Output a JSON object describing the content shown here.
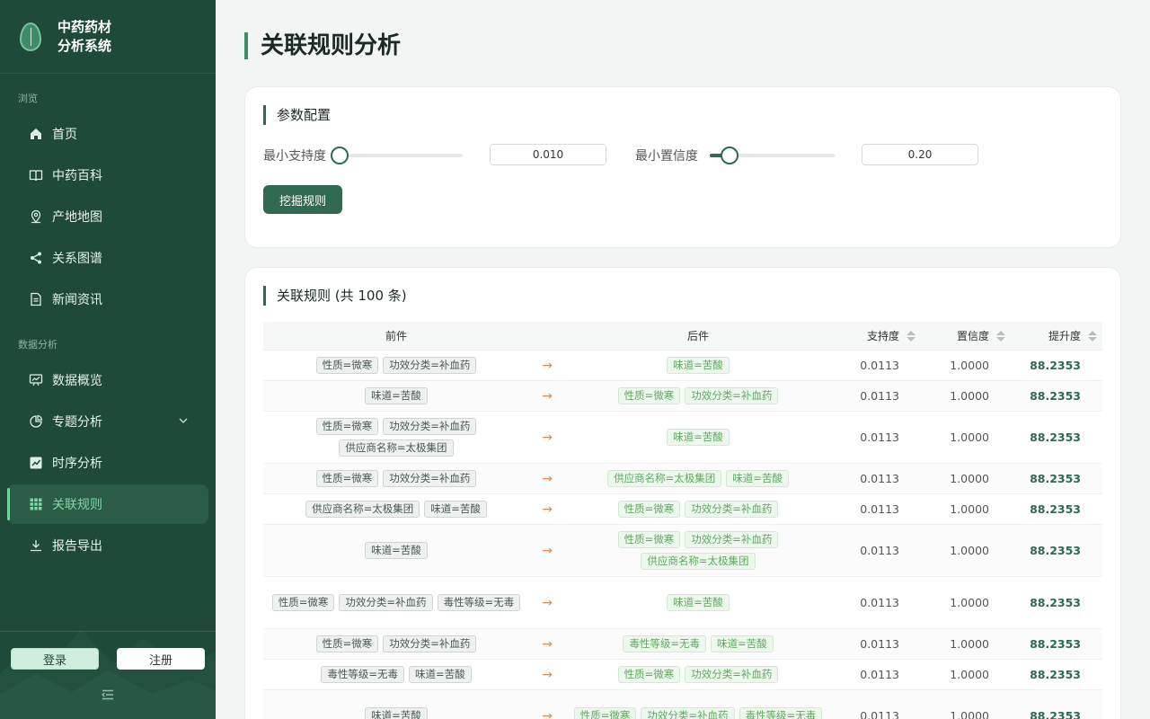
{
  "brand": {
    "title_line1": "中药药材",
    "title_line2": "分析系统"
  },
  "sidebar": {
    "section_browse": "浏览",
    "section_analysis": "数据分析",
    "items": [
      {
        "label": "首页",
        "icon": "home-icon"
      },
      {
        "label": "中药百科",
        "icon": "book-icon"
      },
      {
        "label": "产地地图",
        "icon": "map-pin-icon"
      },
      {
        "label": "关系图谱",
        "icon": "share-icon"
      },
      {
        "label": "新闻资讯",
        "icon": "document-icon"
      },
      {
        "label": "数据概览",
        "icon": "dashboard-icon"
      },
      {
        "label": "专题分析",
        "icon": "pie-chart-icon"
      },
      {
        "label": "时序分析",
        "icon": "line-chart-icon"
      },
      {
        "label": "关联规则",
        "icon": "grid-icon",
        "active": true
      },
      {
        "label": "报告导出",
        "icon": "download-icon"
      }
    ],
    "login_label": "登录",
    "register_label": "注册"
  },
  "page": {
    "title": "关联规则分析"
  },
  "params": {
    "title": "参数配置",
    "min_support_label": "最小支持度",
    "min_support_value": "0.010",
    "min_support_fraction": 0.0,
    "min_confidence_label": "最小置信度",
    "min_confidence_value": "0.20",
    "min_confidence_fraction": 0.16,
    "mine_button": "挖掘规则"
  },
  "rules": {
    "title": "关联规则 (共 100 条)",
    "columns": {
      "antecedent": "前件",
      "consequent": "后件",
      "support": "支持度",
      "confidence": "置信度",
      "lift": "提升度"
    },
    "arrow": "→",
    "rows": [
      {
        "a": [
          "性质=微寒",
          "功效分类=补血药"
        ],
        "c": [
          "味道=苦酸"
        ],
        "support": "0.0113",
        "confidence": "1.0000",
        "lift": "88.2353"
      },
      {
        "a": [
          "味道=苦酸"
        ],
        "c": [
          "性质=微寒",
          "功效分类=补血药"
        ],
        "support": "0.0113",
        "confidence": "1.0000",
        "lift": "88.2353"
      },
      {
        "a": [
          "性质=微寒",
          "功效分类=补血药",
          "供应商名称=太极集团"
        ],
        "c": [
          "味道=苦酸"
        ],
        "support": "0.0113",
        "confidence": "1.0000",
        "lift": "88.2353"
      },
      {
        "a": [
          "性质=微寒",
          "功效分类=补血药"
        ],
        "c": [
          "供应商名称=太极集团",
          "味道=苦酸"
        ],
        "support": "0.0113",
        "confidence": "1.0000",
        "lift": "88.2353"
      },
      {
        "a": [
          "供应商名称=太极集团",
          "味道=苦酸"
        ],
        "c": [
          "性质=微寒",
          "功效分类=补血药"
        ],
        "support": "0.0113",
        "confidence": "1.0000",
        "lift": "88.2353"
      },
      {
        "a": [
          "味道=苦酸"
        ],
        "c": [
          "性质=微寒",
          "功效分类=补血药",
          "供应商名称=太极集团"
        ],
        "support": "0.0113",
        "confidence": "1.0000",
        "lift": "88.2353"
      },
      {
        "a": [
          "性质=微寒",
          "功效分类=补血药",
          "毒性等级=无毒"
        ],
        "c": [
          "味道=苦酸"
        ],
        "support": "0.0113",
        "confidence": "1.0000",
        "lift": "88.2353"
      },
      {
        "a": [
          "性质=微寒",
          "功效分类=补血药"
        ],
        "c": [
          "毒性等级=无毒",
          "味道=苦酸"
        ],
        "support": "0.0113",
        "confidence": "1.0000",
        "lift": "88.2353"
      },
      {
        "a": [
          "毒性等级=无毒",
          "味道=苦酸"
        ],
        "c": [
          "性质=微寒",
          "功效分类=补血药"
        ],
        "support": "0.0113",
        "confidence": "1.0000",
        "lift": "88.2353"
      },
      {
        "a": [
          "味道=苦酸"
        ],
        "c": [
          "性质=微寒",
          "功效分类=补血药",
          "毒性等级=无毒"
        ],
        "support": "0.0113",
        "confidence": "1.0000",
        "lift": "88.2353"
      }
    ]
  }
}
